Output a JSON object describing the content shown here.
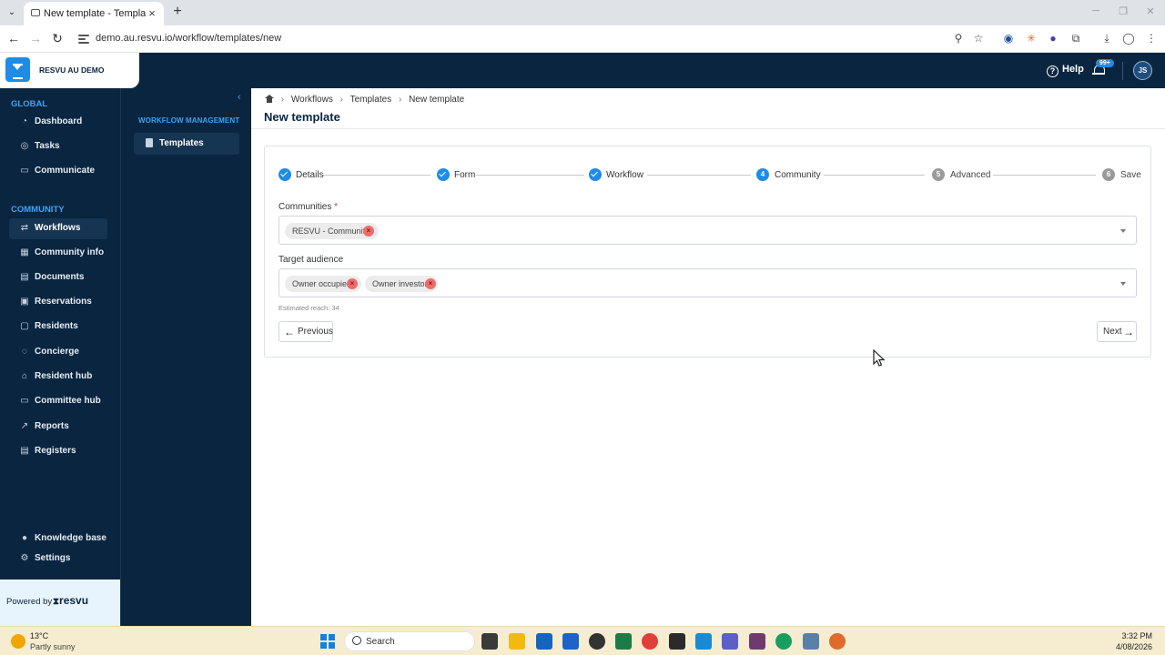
{
  "browser": {
    "tab_title": "New template - Templates - W",
    "url": "demo.au.resvu.io/workflow/templates/new"
  },
  "header": {
    "org_name": "RESVU AU DEMO",
    "help_label": "Help",
    "notification_badge": "99+",
    "avatar_initials": "JS",
    "brand_color": "#0a2540",
    "accent_color": "#1e8ce6"
  },
  "sidebar": {
    "global_title": "GLOBAL",
    "global_items": [
      {
        "label": "Dashboard",
        "icon": "dashboard-icon"
      },
      {
        "label": "Tasks",
        "icon": "tasks-icon"
      },
      {
        "label": "Communicate",
        "icon": "communicate-icon"
      }
    ],
    "community_title": "COMMUNITY",
    "community_items": [
      {
        "label": "Workflows",
        "icon": "workflows-icon",
        "active": true
      },
      {
        "label": "Community info",
        "icon": "community-info-icon"
      },
      {
        "label": "Documents",
        "icon": "documents-icon"
      },
      {
        "label": "Reservations",
        "icon": "reservations-icon"
      },
      {
        "label": "Residents",
        "icon": "residents-icon"
      },
      {
        "label": "Concierge",
        "icon": "concierge-icon"
      },
      {
        "label": "Resident hub",
        "icon": "resident-hub-icon"
      },
      {
        "label": "Committee hub",
        "icon": "committee-hub-icon"
      },
      {
        "label": "Reports",
        "icon": "reports-icon"
      },
      {
        "label": "Registers",
        "icon": "registers-icon"
      }
    ],
    "bottom_items": [
      {
        "label": "Knowledge base",
        "icon": "knowledge-base-icon"
      },
      {
        "label": "Settings",
        "icon": "settings-icon"
      }
    ],
    "powered_by": "Powered by",
    "powered_logo": "resvu"
  },
  "subsidebar": {
    "title": "WORKFLOW MANAGEMENT",
    "items": [
      {
        "label": "Templates",
        "icon": "templates-icon"
      }
    ]
  },
  "breadcrumb": [
    "Workflows",
    "Templates",
    "New template"
  ],
  "page_title": "New template",
  "steps": [
    {
      "label": "Details",
      "status": "done"
    },
    {
      "label": "Form",
      "status": "done"
    },
    {
      "label": "Workflow",
      "status": "done"
    },
    {
      "label": "Community",
      "status": "current",
      "number": "4"
    },
    {
      "label": "Advanced",
      "status": "todo",
      "number": "5"
    },
    {
      "label": "Save",
      "status": "todo",
      "number": "6"
    }
  ],
  "form": {
    "communities_label": "Communities",
    "required_mark": "*",
    "communities_selected": [
      "RESVU - Community"
    ],
    "audience_label": "Target audience",
    "audience_selected": [
      "Owner occupier",
      "Owner investor"
    ],
    "estimated_reach": "Estimated reach: 34"
  },
  "buttons": {
    "previous": "Previous",
    "next": "Next"
  },
  "taskbar": {
    "temperature": "13°C",
    "weather": "Partly sunny",
    "search_label": "Search",
    "time": "3:32 PM",
    "date": "4/08/2026"
  }
}
